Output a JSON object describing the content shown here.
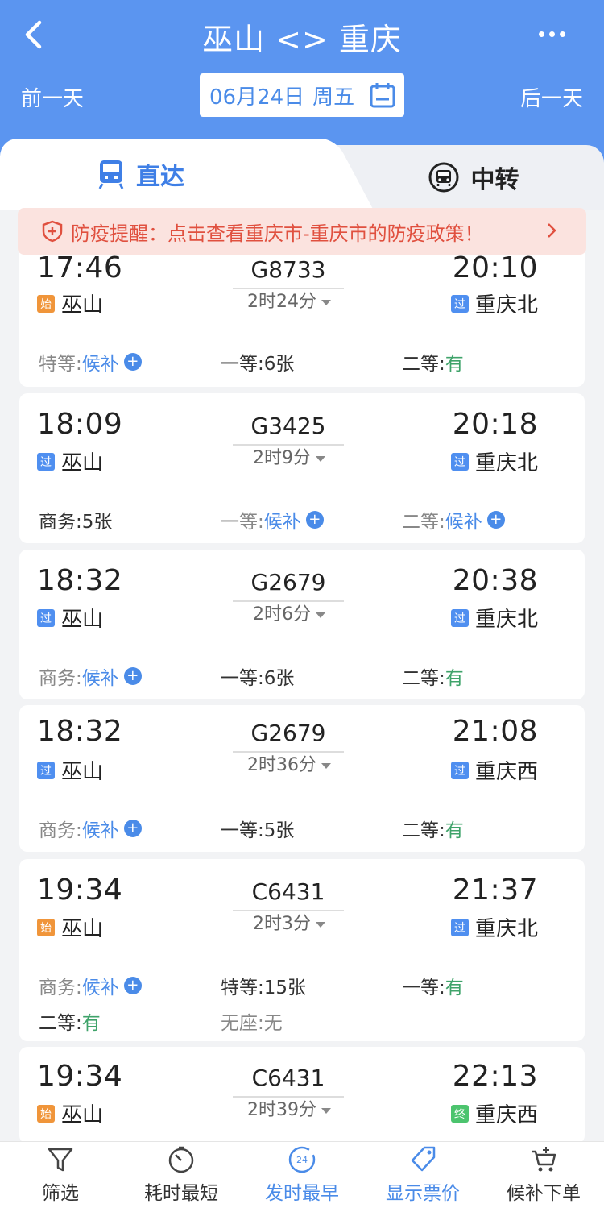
{
  "header": {
    "title": "巫山 <> 重庆",
    "prev_day": "前一天",
    "next_day": "后一天",
    "date": "06月24日",
    "weekday": "周五"
  },
  "tabs": {
    "direct": "直达",
    "transfer": "中转"
  },
  "notice": {
    "text": "防疫提醒：点击查看重庆市-重庆市的防疫政策！"
  },
  "trains": [
    {
      "dep_time": "17:46",
      "dep_station": "巫山",
      "dep_badge": "始",
      "train_no": "G8733",
      "duration": "2时24分",
      "arr_time": "20:10",
      "arr_station": "重庆北",
      "arr_badge": "过",
      "seats": [
        {
          "label": "特等:",
          "value": "候补"
        },
        {
          "label": "一等:",
          "value": "6张"
        },
        {
          "label": "二等:",
          "value": "有"
        }
      ]
    },
    {
      "dep_time": "18:09",
      "dep_station": "巫山",
      "dep_badge": "过",
      "train_no": "G3425",
      "duration": "2时9分",
      "arr_time": "20:18",
      "arr_station": "重庆北",
      "arr_badge": "过",
      "seats": [
        {
          "label": "商务:",
          "value": "5张"
        },
        {
          "label": "一等:",
          "value": "候补"
        },
        {
          "label": "二等:",
          "value": "候补"
        }
      ]
    },
    {
      "dep_time": "18:32",
      "dep_station": "巫山",
      "dep_badge": "过",
      "train_no": "G2679",
      "duration": "2时6分",
      "arr_time": "20:38",
      "arr_station": "重庆北",
      "arr_badge": "过",
      "seats": [
        {
          "label": "商务:",
          "value": "候补"
        },
        {
          "label": "一等:",
          "value": "6张"
        },
        {
          "label": "二等:",
          "value": "有"
        }
      ]
    },
    {
      "dep_time": "18:32",
      "dep_station": "巫山",
      "dep_badge": "过",
      "train_no": "G2679",
      "duration": "2时36分",
      "arr_time": "21:08",
      "arr_station": "重庆西",
      "arr_badge": "过",
      "seats": [
        {
          "label": "商务:",
          "value": "候补"
        },
        {
          "label": "一等:",
          "value": "5张"
        },
        {
          "label": "二等:",
          "value": "有"
        }
      ]
    },
    {
      "dep_time": "19:34",
      "dep_station": "巫山",
      "dep_badge": "始",
      "train_no": "C6431",
      "duration": "2时3分",
      "arr_time": "21:37",
      "arr_station": "重庆北",
      "arr_badge": "过",
      "seats": [
        {
          "label": "商务:",
          "value": "候补"
        },
        {
          "label": "特等:",
          "value": "15张"
        },
        {
          "label": "一等:",
          "value": "有"
        },
        {
          "label": "二等:",
          "value": "有"
        },
        {
          "label": "无座:",
          "value": "无"
        }
      ]
    },
    {
      "dep_time": "19:34",
      "dep_station": "巫山",
      "dep_badge": "始",
      "train_no": "C6431",
      "duration": "2时39分",
      "arr_time": "22:13",
      "arr_station": "重庆西",
      "arr_badge": "终"
    }
  ],
  "bottom_bar": [
    {
      "label": "筛选",
      "icon": "filter-icon"
    },
    {
      "label": "耗时最短",
      "icon": "timer-icon"
    },
    {
      "label": "发时最早",
      "icon": "clock-24-icon",
      "badge": "24"
    },
    {
      "label": "显示票价",
      "icon": "price-tag-icon"
    },
    {
      "label": "候补下单",
      "icon": "cart-icon"
    }
  ],
  "colors": {
    "header_bg": "#5b95f0",
    "accent_blue": "#4a8be8",
    "available_green": "#3fa36a",
    "notice_red": "#e0503f",
    "badge_start": "#f0953a",
    "badge_pass": "#4f8ff0",
    "badge_end": "#4cc46e"
  }
}
